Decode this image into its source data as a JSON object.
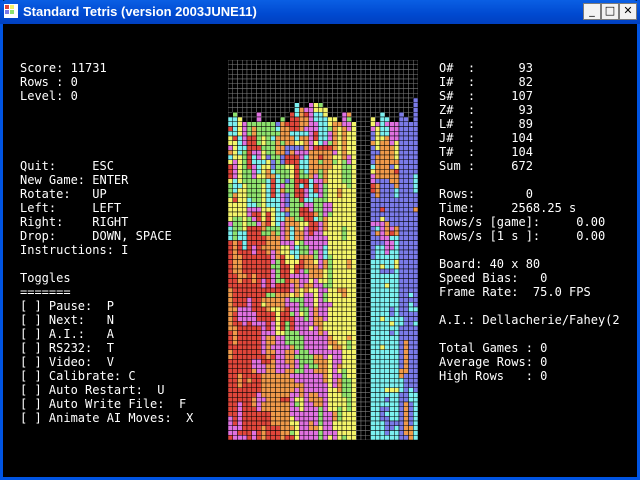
{
  "window": {
    "title": "Standard Tetris (version 2003JUNE11)"
  },
  "titlebar_buttons": {
    "minimize": "_",
    "maximize": "□",
    "close": "✕"
  },
  "left_panel": {
    "score": "Score: 11731",
    "rows": "Rows : 0",
    "level": "Level: 0",
    "controls": [
      "Quit:     ESC",
      "New Game: ENTER",
      "Rotate:   UP",
      "Left:     LEFT",
      "Right:    RIGHT",
      "Drop:     DOWN, SPACE",
      "Instructions: I"
    ],
    "toggles_header": "Toggles",
    "toggles_underline": "=======",
    "toggles": [
      "[ ] Pause:  P",
      "[ ] Next:   N",
      "[ ] A.I.:   A",
      "[ ] RS232:  T",
      "[ ] Video:  V",
      "[ ] Calibrate: C",
      "[ ] Auto Restart:  U",
      "[ ] Auto Write File:  F",
      "[ ] Animate AI Moves:  X"
    ]
  },
  "right_panel": {
    "piece_counts": [
      "O#  :      93",
      "I#  :      82",
      "S#  :     107",
      "Z#  :      93",
      "L#  :      89",
      "J#  :     104",
      "T#  :     104",
      "Sum :     672"
    ],
    "stats": [
      "Rows:       0",
      "Time:     2568.25 s",
      "Rows/s [game]:     0.00",
      "Rows/s [1 s ]:     0.00"
    ],
    "board_info": [
      "Board: 40 x 80",
      "Speed Bias:   0",
      "Frame Rate:  75.0 FPS"
    ],
    "ai": "A.I.: Dellacherie/Fahey(2",
    "totals": [
      "Total Games : 0",
      "Average Rows: 0",
      "High Rows   : 0"
    ]
  },
  "board": {
    "columns": 40,
    "rows": 80,
    "colors": {
      "red": "#E0463A",
      "magenta": "#E071E0",
      "green": "#8EE26E",
      "yellow": "#F4F46A",
      "cyan": "#7BF0F0",
      "orange": "#F09A4A",
      "blue": "#7A7AE8",
      "grid": "#808080"
    }
  },
  "colors": {
    "text": "#FFFFFF",
    "background": "#000000",
    "titlebar": "#0054E3"
  }
}
